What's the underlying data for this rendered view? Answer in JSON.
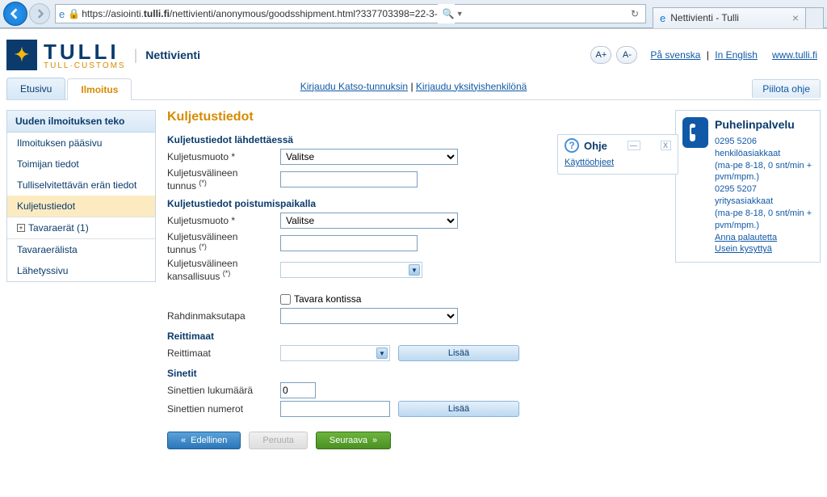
{
  "browser": {
    "url_prefix": "https://",
    "url_host_pre": "asiointi.",
    "url_host_bold": "tulli.fi",
    "url_path": "/nettivienti/anonymous/goodsshipment.html?337703398=22-3-",
    "tab_title": "Nettivienti - Tulli"
  },
  "header": {
    "logo_main": "TULLI",
    "logo_sub": "TULL·CUSTOMS",
    "app_title": "Nettivienti",
    "font_plus": "A+",
    "font_minus": "A-",
    "lang_sv": "På svenska",
    "lang_en": "In English",
    "site_link": "www.tulli.fi"
  },
  "nav": {
    "tab_home": "Etusivu",
    "tab_ilmoitus": "Ilmoitus",
    "login_katso": "Kirjaudu Katso-tunnuksin",
    "login_henk": "Kirjaudu yksityishenkilönä",
    "hide_help": "Piilota ohje"
  },
  "sidebar": {
    "title": "Uuden ilmoituksen teko",
    "items": [
      "Ilmoituksen pääsivu",
      "Toimijan tiedot",
      "Tulliselvitettävän erän tiedot",
      "Kuljetustiedot",
      "Tavaraerät (1)",
      "Tavaraerälista",
      "Lähetyssivu"
    ]
  },
  "content": {
    "title": "Kuljetustiedot",
    "sect1": {
      "heading": "Kuljetustiedot lähdettäessä",
      "mode_label": "Kuljetusmuoto *",
      "mode_value": "Valitse",
      "id_label_a": "Kuljetusvälineen",
      "id_label_b": "tunnus",
      "id_sup": "(*)"
    },
    "sect2": {
      "heading": "Kuljetustiedot poistumispaikalla",
      "mode_label": "Kuljetusmuoto *",
      "mode_value": "Valitse",
      "id_label_a": "Kuljetusvälineen",
      "id_label_b": "tunnus",
      "id_sup": "(*)",
      "nat_label_a": "Kuljetusvälineen",
      "nat_label_b": "kansallisuus",
      "nat_sup": "(*)"
    },
    "container_label": "Tavara kontissa",
    "freight_label": "Rahdinmaksutapa",
    "sect3": {
      "heading": "Reittimaat",
      "label": "Reittimaat",
      "add": "Lisää"
    },
    "sect4": {
      "heading": "Sinetit",
      "count_label": "Sinettien lukumäärä",
      "count_value": "0",
      "numbers_label": "Sinettien numerot",
      "add": "Lisää"
    },
    "buttons": {
      "prev": "Edellinen",
      "cancel": "Peruuta",
      "next": "Seuraava"
    }
  },
  "ohje": {
    "title": "Ohje",
    "link": "Käyttöohjeet"
  },
  "puhelin": {
    "title": "Puhelinpalvelu",
    "line1a": "0295 5206 henkilöasiakkaat",
    "line1b": "(ma-pe 8-18, 0 snt/min + pvm/mpm.)",
    "line2a": "0295 5207 yritysasiakkaat",
    "line2b": "(ma-pe 8-18, 0 snt/min + pvm/mpm.)",
    "link1": "Anna palautetta",
    "link2": "Usein kysyttyä"
  }
}
